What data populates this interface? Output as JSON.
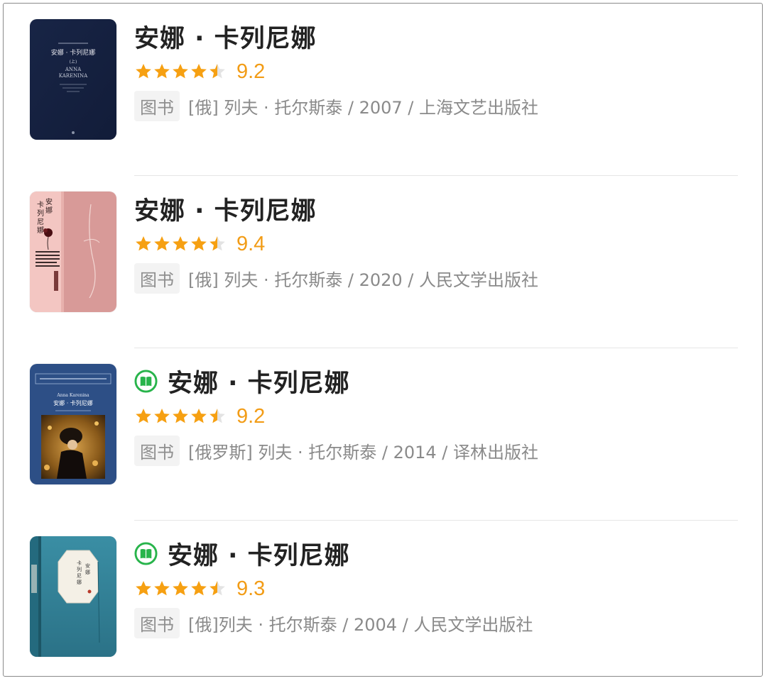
{
  "colors": {
    "star": "#f6a012",
    "score": "#f29c16",
    "read_badge": "#28b44b"
  },
  "books": [
    {
      "title": "安娜 · 卡列尼娜",
      "has_read_badge": false,
      "rating": 4.5,
      "score": "9.2",
      "tag": "图书",
      "meta": "[俄] 列夫 · 托尔斯泰 / 2007 / 上海文艺出版社",
      "cover": "cover-1",
      "cover_text": {
        "title": "安娜 · 卡列尼娜",
        "series": "(上)",
        "en": "ANNA\nKARENINA"
      }
    },
    {
      "title": "安娜 · 卡列尼娜",
      "has_read_badge": false,
      "rating": 4.5,
      "score": "9.4",
      "tag": "图书",
      "meta": "[俄] 列夫 · 托尔斯泰 / 2020 / 人民文学出版社",
      "cover": "cover-2",
      "cover_text": {
        "title": "安娜 · 卡列尼娜"
      }
    },
    {
      "title": "安娜 · 卡列尼娜",
      "has_read_badge": true,
      "rating": 4.5,
      "score": "9.2",
      "tag": "图书",
      "meta": "[俄罗斯] 列夫 · 托尔斯泰 / 2014 / 译林出版社",
      "cover": "cover-3",
      "cover_text": {
        "en": "Anna Karenina",
        "title": "安娜 · 卡列尼娜"
      }
    },
    {
      "title": "安娜 · 卡列尼娜",
      "has_read_badge": true,
      "rating": 4.5,
      "score": "9.3",
      "tag": "图书",
      "meta": "[俄]列夫 · 托尔斯泰 / 2004 / 人民文学出版社",
      "cover": "cover-4",
      "cover_text": {
        "title": "安娜 · 卡列尼娜"
      }
    }
  ]
}
